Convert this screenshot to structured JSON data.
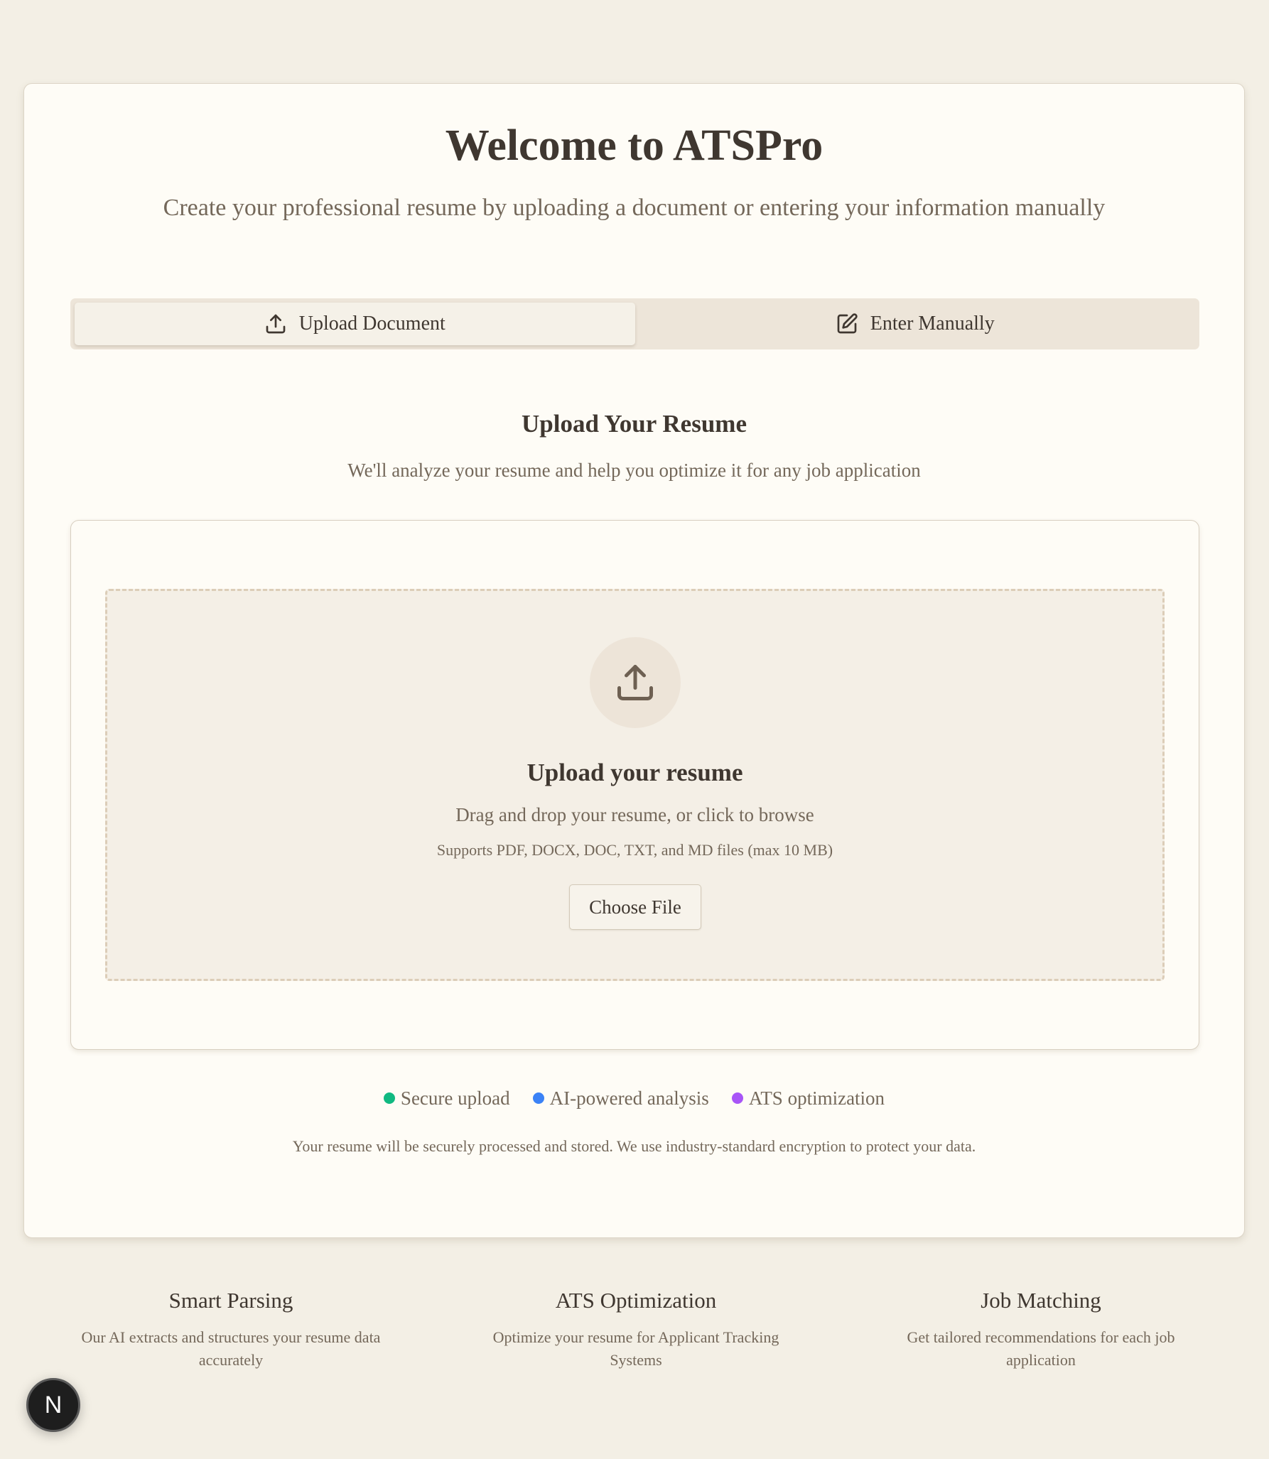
{
  "header": {
    "title": "Welcome to ATSPro",
    "subtitle": "Create your professional resume by uploading a document or entering your information manually"
  },
  "tabs": [
    {
      "label": "Upload Document",
      "icon": "upload-icon",
      "active": true
    },
    {
      "label": "Enter Manually",
      "icon": "edit-icon",
      "active": false
    }
  ],
  "upload_section": {
    "title": "Upload Your Resume",
    "subtitle": "We'll analyze your resume and help you optimize it for any job application"
  },
  "dropzone": {
    "icon": "upload-icon",
    "title": "Upload your resume",
    "text": "Drag and drop your resume, or click to browse",
    "hint": "Supports PDF, DOCX, DOC, TXT, and MD files (max 10 MB)",
    "button_label": "Choose File"
  },
  "features": [
    {
      "label": "Secure upload",
      "color": "#10b981"
    },
    {
      "label": "AI-powered analysis",
      "color": "#3b82f6"
    },
    {
      "label": "ATS optimization",
      "color": "#a855f7"
    }
  ],
  "privacy_note": "Your resume will be securely processed and stored. We use industry-standard encryption to protect your data.",
  "bottom_features": [
    {
      "title": "Smart Parsing",
      "description": "Our AI extracts and structures your resume data accurately"
    },
    {
      "title": "ATS Optimization",
      "description": "Optimize your resume for Applicant Tracking Systems"
    },
    {
      "title": "Job Matching",
      "description": "Get tailored recommendations for each job application"
    }
  ],
  "dev_badge": {
    "label": "N"
  },
  "colors": {
    "background": "#f3efe5",
    "card": "#fefcf6",
    "text_primary": "#3f3730",
    "text_muted": "#74685a",
    "tab_track": "#ede5d9"
  }
}
